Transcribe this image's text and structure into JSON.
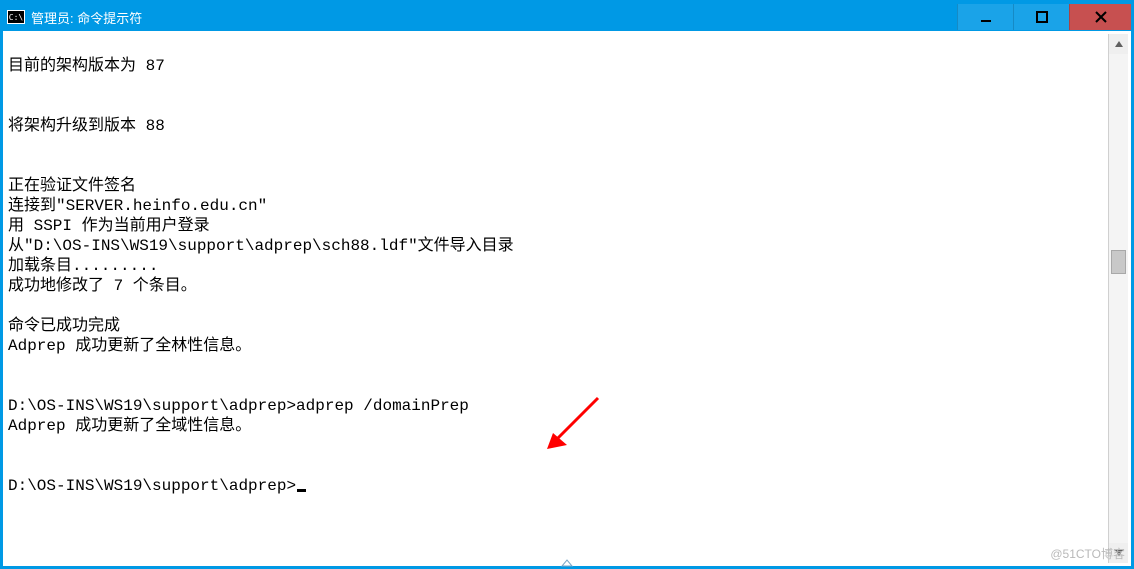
{
  "window": {
    "icon_label": "C:\\",
    "title": "管理员: 命令提示符"
  },
  "console": {
    "lines": [
      "",
      "目前的架构版本为 87",
      "",
      "",
      "将架构升级到版本 88",
      "",
      "",
      "正在验证文件签名",
      "连接到\"SERVER.heinfo.edu.cn\"",
      "用 SSPI 作为当前用户登录",
      "从\"D:\\OS-INS\\WS19\\support\\adprep\\sch88.ldf\"文件导入目录",
      "加载条目.........",
      "成功地修改了 7 个条目。",
      "",
      "命令已成功完成",
      "Adprep 成功更新了全林性信息。",
      "",
      "",
      "D:\\OS-INS\\WS19\\support\\adprep>adprep /domainPrep",
      "Adprep 成功更新了全域性信息。",
      "",
      "",
      "D:\\OS-INS\\WS19\\support\\adprep>"
    ],
    "prompt_has_cursor": true
  },
  "annotation": {
    "arrow_color": "#ff0000"
  },
  "watermark": "@51CTO博客"
}
